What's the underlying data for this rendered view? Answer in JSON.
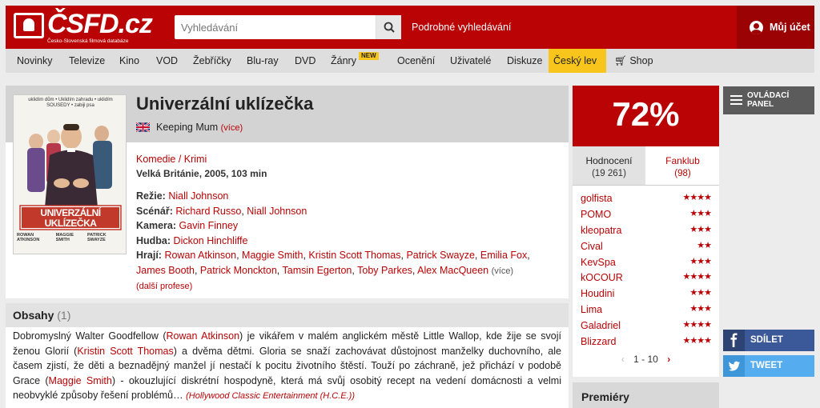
{
  "header": {
    "logo_text": "ČSFD.cz",
    "logo_sub": "Česko-Slovenská filmová databáze",
    "search_placeholder": "Vyhledávání",
    "advanced_search": "Podrobné vyhledávání",
    "account": "Můj účet"
  },
  "nav": {
    "items": [
      "Novinky",
      "Televize",
      "Kino",
      "VOD",
      "Žebříčky",
      "Blu-ray",
      "DVD",
      "Žánry",
      "Ocenění",
      "Uživatelé",
      "Diskuze",
      "Český lev",
      "Shop"
    ],
    "new_badge": "NEW"
  },
  "film": {
    "title": "Univerzální uklízečka",
    "alt_title": "Keeping Mum",
    "alt_title_more": "(více)",
    "genres": [
      "Komedie",
      "Krimi"
    ],
    "genre_sep": " / ",
    "origin": "Velká Británie, 2005, 103 min",
    "credits": {
      "director_label": "Režie:",
      "director": "Niall Johnson",
      "writer_label": "Scénář:",
      "writers": [
        "Richard Russo",
        "Niall Johnson"
      ],
      "camera_label": "Kamera:",
      "camera": "Gavin Finney",
      "music_label": "Hudba:",
      "music": "Dickon Hinchliffe",
      "cast_label": "Hrají:",
      "cast": [
        "Rowan Atkinson",
        "Maggie Smith",
        "Kristin Scott Thomas",
        "Patrick Swayze",
        "Emilia Fox",
        "James Booth",
        "Patrick Monckton",
        "Tamsin Egerton",
        "Toby Parkes",
        "Alex MacQueen"
      ],
      "cast_more": "(více)",
      "more_roles": "(další profese)"
    },
    "poster": {
      "tagline": "uklidím dům • Uklidím zahradu • uklidím SOUSEDY • zabiji psa",
      "title_line1": "UNIVERZÁLNÍ",
      "title_line2": "UKLÍZEČKA",
      "names": [
        "ROWAN ATKINSON",
        "MAGGIE SMITH",
        "PATRICK SWAYZE"
      ]
    }
  },
  "synopsis": {
    "heading": "Obsahy",
    "count": "(1)",
    "text_parts": [
      "Dobromyslný Walter Goodfellow (",
      "Rowan Atkinson",
      ") je vikářem v malém anglickém městě Little Wallop, kde žije se svojí ženou Glorií (",
      "Kristin Scott Thomas",
      ") a dvěma dětmi. Gloria se snaží zachovávat důstojnost manželky duchovního, ale časem zjistí, že děti a beznadějný manžel jí nestačí k pocitu životního štěstí. Touží po záchraně, jež přichází v podobě Grace (",
      "Maggie Smith",
      ") - okouzlující diskrétní hospodyně, která má svůj osobitý recept na vedení domácnosti a velmi neobvyklé způsoby řešení problémů… "
    ],
    "source": "(Hollywood Classic Entertainment (H.C.E.))"
  },
  "rating": {
    "value": "72%",
    "tab_ratings": "Hodnocení",
    "tab_ratings_count": "(19 261)",
    "tab_fanclub": "Fanklub",
    "tab_fanclub_count": "(98)",
    "users": [
      {
        "name": "golfista",
        "stars": "★★★★"
      },
      {
        "name": "POMO",
        "stars": "★★★"
      },
      {
        "name": "kleopatra",
        "stars": "★★★"
      },
      {
        "name": "Cival",
        "stars": "★★"
      },
      {
        "name": "KevSpa",
        "stars": "★★★"
      },
      {
        "name": "kOCOUR",
        "stars": "★★★★"
      },
      {
        "name": "Houdini",
        "stars": "★★★"
      },
      {
        "name": "Lima",
        "stars": "★★★"
      },
      {
        "name": "Galadriel",
        "stars": "★★★★"
      },
      {
        "name": "Blizzard",
        "stars": "★★★★"
      }
    ],
    "pager": "1 - 10"
  },
  "premiery": "Premiéry",
  "side": {
    "control_panel_line1": "OVLÁDACÍ",
    "control_panel_line2": "PANEL",
    "share": "SDÍLET",
    "tweet": "TWEET"
  },
  "colors": {
    "brand_red": "#ba0305",
    "highlight_yellow": "#f7c51c",
    "facebook": "#3b5998",
    "twitter": "#55acee"
  }
}
